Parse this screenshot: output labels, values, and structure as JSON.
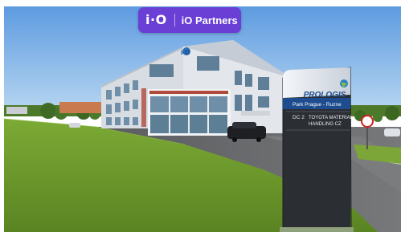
{
  "badge": {
    "logo_text": "i·O",
    "label": "iO Partners"
  },
  "signage": {
    "brand": "PROLOGIS",
    "park_name": "Park Prague - Ruzne",
    "unit_code": "DC 2",
    "tenant_line_1": "TOYOTA MATERIAL",
    "tenant_line_2": "HANDLING CZ"
  },
  "building": {
    "facade_logo": "i·O"
  },
  "colors": {
    "sky": "#7fb2e6",
    "grass": "#6d9a2c",
    "asphalt": "#6a6a6c",
    "badge": "#6a3fd6",
    "brand_blue": "#1d4c8f",
    "pylon_dark": "#2b2e33"
  }
}
